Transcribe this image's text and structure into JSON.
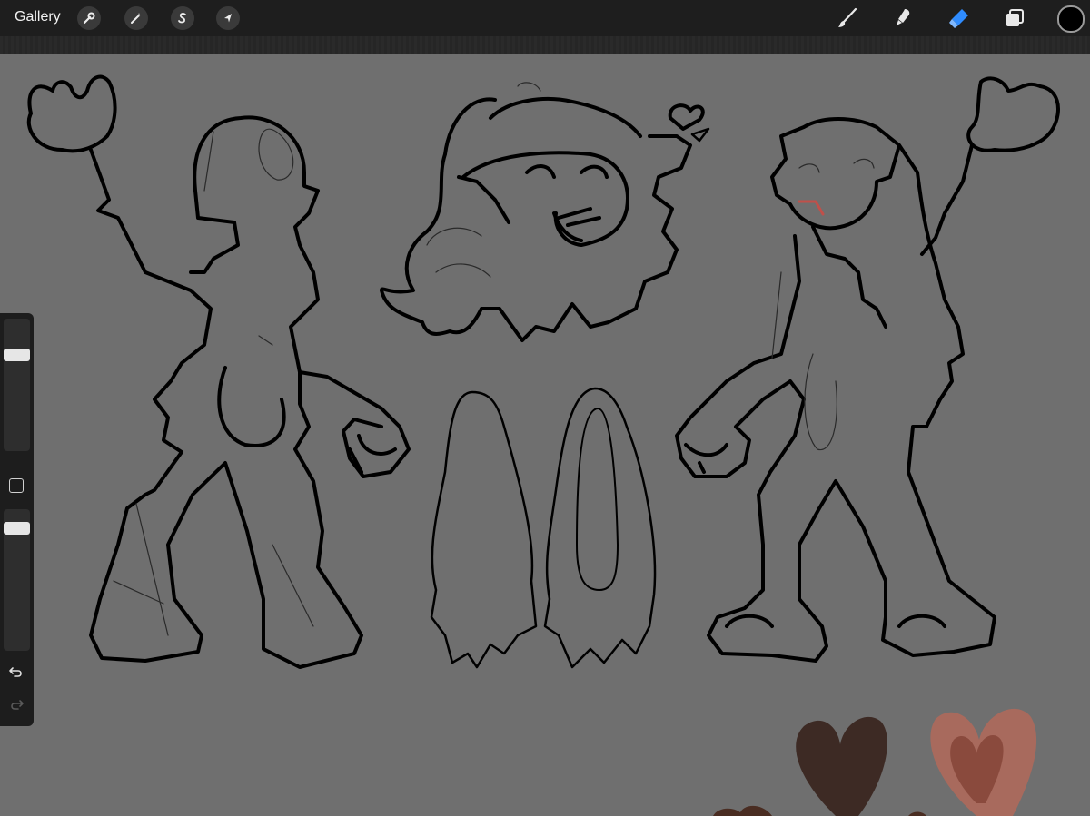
{
  "topbar": {
    "gallery_label": "Gallery",
    "left_tools": [
      {
        "name": "actions",
        "icon": "wrench-icon"
      },
      {
        "name": "adjustments",
        "icon": "magic-wand-icon"
      },
      {
        "name": "selection",
        "icon": "selection-s-icon"
      },
      {
        "name": "transform",
        "icon": "arrow-cursor-icon"
      }
    ],
    "right_tools": [
      {
        "name": "brush",
        "icon": "brush-icon",
        "active": false
      },
      {
        "name": "smudge",
        "icon": "smudge-icon",
        "active": false
      },
      {
        "name": "eraser",
        "icon": "eraser-icon",
        "active": true
      },
      {
        "name": "layers",
        "icon": "layers-icon",
        "active": false
      }
    ],
    "current_color": "#000000",
    "active_tool_color": "#2f8cff"
  },
  "sidebar": {
    "brush_size_level": 0.25,
    "opacity_level": 0.1,
    "undo_icon": "undo-arrow-icon",
    "redo_icon": "redo-arrow-icon"
  },
  "canvas": {
    "background_color": "#6f6f6f",
    "palette_swatches": [
      "#3d2a24",
      "#a86a5d",
      "#8a4a3d",
      "#4a2d22"
    ]
  }
}
